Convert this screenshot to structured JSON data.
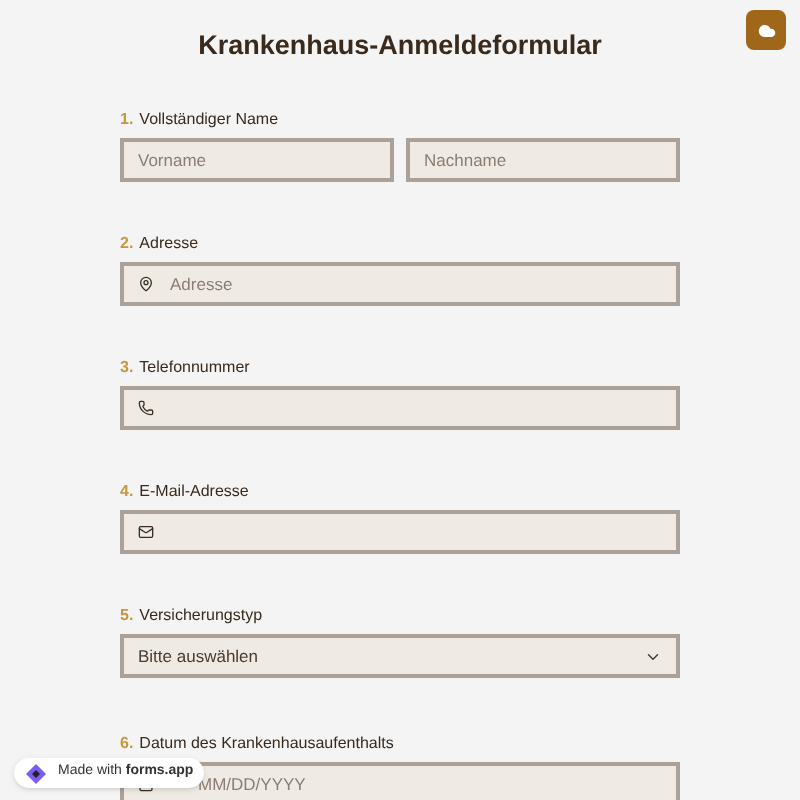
{
  "title": "Krankenhaus-Anmeldeformular",
  "questions": [
    {
      "number": "1.",
      "label": "Vollständiger Name",
      "fields": [
        {
          "kind": "text",
          "placeholder": "Vorname"
        },
        {
          "kind": "text",
          "placeholder": "Nachname"
        }
      ]
    },
    {
      "number": "2.",
      "label": "Adresse",
      "fields": [
        {
          "kind": "address",
          "placeholder": "Adresse"
        }
      ]
    },
    {
      "number": "3.",
      "label": "Telefonnummer",
      "fields": [
        {
          "kind": "phone"
        }
      ]
    },
    {
      "number": "4.",
      "label": "E-Mail-Adresse",
      "fields": [
        {
          "kind": "email"
        }
      ]
    },
    {
      "number": "5.",
      "label": "Versicherungstyp",
      "fields": [
        {
          "kind": "select",
          "value": "Bitte auswählen"
        }
      ]
    },
    {
      "number": "6.",
      "label": "Datum des Krankenhausaufenthalts",
      "fields": [
        {
          "kind": "date",
          "placeholder": "MM/DD/YYYY"
        }
      ]
    }
  ],
  "badge": "Made with **forms.app**"
}
